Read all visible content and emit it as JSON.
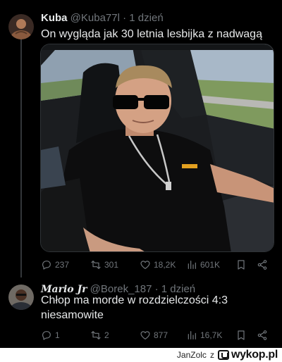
{
  "tweets": [
    {
      "display_name": "Kuba",
      "handle": "@Kuba77l",
      "separator": "·",
      "time": "1 dzień",
      "text": "On wygląda jak 30 letnia lesbijka z nadwagą",
      "has_media": true,
      "stats": {
        "replies": "237",
        "retweets": "301",
        "likes": "18,2K",
        "views": "601K"
      }
    },
    {
      "display_name": "Mario Jr",
      "handle": "@Borek_187",
      "separator": "·",
      "time": "1 dzień",
      "text_line1": "Chłop ma morde w rozdzielczości 4:3",
      "text_line2": "niesamowite",
      "stats": {
        "replies": "1",
        "retweets": "2",
        "likes": "877",
        "views": "16,7K"
      }
    }
  ],
  "icons": {
    "reply": "reply-icon",
    "retweet": "retweet-icon",
    "like": "heart-icon",
    "views": "views-icon",
    "bookmark": "bookmark-icon",
    "share": "share-icon"
  },
  "footer": {
    "user": "JanZolc",
    "preposition": "z",
    "site": "wykop.pl"
  },
  "colors": {
    "background": "#000000",
    "text": "#e7e9ea",
    "muted": "#71767b",
    "divider": "#2f3336"
  }
}
